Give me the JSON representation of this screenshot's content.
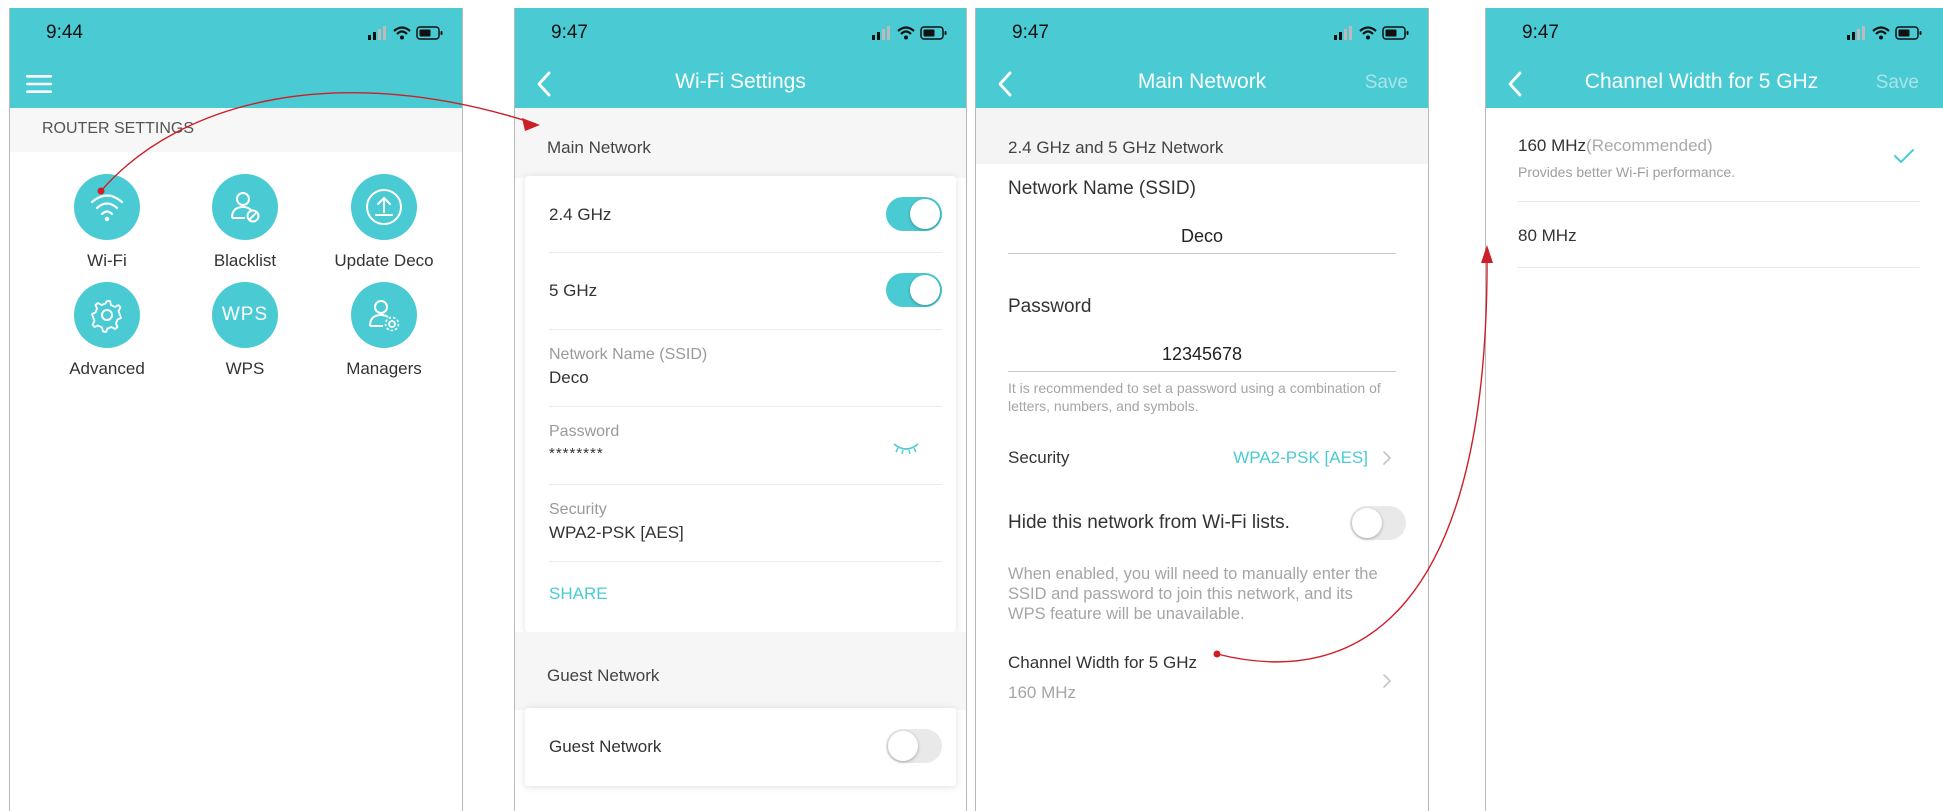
{
  "colors": {
    "accent": "#4acbd4",
    "arrow": "#cc1f28"
  },
  "panel1": {
    "time": "9:44",
    "section": "ROUTER SETTINGS",
    "tools": [
      {
        "label": "Wi-Fi",
        "icon": "wifi-icon"
      },
      {
        "label": "Blacklist",
        "icon": "blocked-user-icon"
      },
      {
        "label": "Update Deco",
        "icon": "upload-icon"
      },
      {
        "label": "Advanced",
        "icon": "gear-icon"
      },
      {
        "label": "WPS",
        "icon": "wps-icon"
      },
      {
        "label": "Managers",
        "icon": "manager-icon"
      }
    ],
    "wps_text": "WPS"
  },
  "panel2": {
    "time": "9:47",
    "title": "Wi-Fi Settings",
    "main_section": "Main Network",
    "band_24": "2.4 GHz",
    "band_5": "5 GHz",
    "ssid_label": "Network Name (SSID)",
    "ssid_value": "Deco",
    "password_label": "Password",
    "password_value": "********",
    "security_label": "Security",
    "security_value": "WPA2-PSK [AES]",
    "share": "SHARE",
    "guest_section": "Guest Network",
    "guest_row": "Guest Network",
    "toggles": {
      "band_24": true,
      "band_5": true,
      "guest": false
    }
  },
  "panel3": {
    "time": "9:47",
    "title": "Main Network",
    "save": "Save",
    "section": "2.4 GHz and 5 GHz Network",
    "ssid_label": "Network Name (SSID)",
    "ssid_value": "Deco",
    "password_label": "Password",
    "password_value": "12345678",
    "password_hint": "It is recommended to set a password using a combination of letters, numbers, and symbols.",
    "security_label": "Security",
    "security_value": "WPA2-PSK [AES]",
    "hide_label": "Hide this network from Wi-Fi lists.",
    "hide_hint": "When enabled, you will need to manually enter the SSID and password to join this network, and its WPS feature will be unavailable.",
    "channel_label": "Channel Width for 5 GHz",
    "channel_value": "160 MHz",
    "hide_toggle": false
  },
  "panel4": {
    "time": "9:47",
    "title": "Channel Width for 5 GHz",
    "save": "Save",
    "options": [
      {
        "label": "160 MHz",
        "tag": "(Recommended)",
        "desc": "Provides better Wi-Fi performance.",
        "selected": true
      },
      {
        "label": "80 MHz",
        "tag": "",
        "desc": "",
        "selected": false
      }
    ]
  }
}
